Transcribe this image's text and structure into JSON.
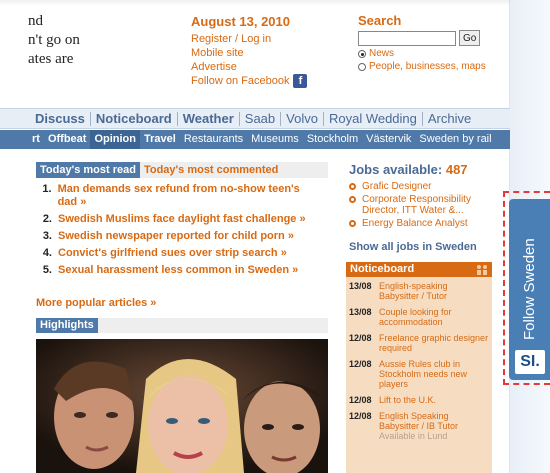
{
  "teaser": {
    "lines": [
      "nd",
      "n't go on",
      "ates are"
    ]
  },
  "header": {
    "date": "August 13, 2010",
    "links": [
      {
        "label": "Register / Log in"
      },
      {
        "label": "Mobile site"
      },
      {
        "label": "Advertise"
      },
      {
        "label": "Follow on Facebook"
      }
    ],
    "facebook_icon": "f"
  },
  "search": {
    "title": "Search",
    "input_value": "",
    "go_label": "Go",
    "options": [
      {
        "label": "News",
        "selected": true
      },
      {
        "label": "People, businesses, maps",
        "selected": false
      }
    ]
  },
  "main_nav": {
    "items": [
      {
        "label": "Discuss",
        "bold": true
      },
      {
        "label": "Noticeboard",
        "bold": true
      },
      {
        "label": "Weather",
        "bold": true
      },
      {
        "label": "Saab",
        "bold": false
      },
      {
        "label": "Volvo",
        "bold": false
      },
      {
        "label": "Royal Wedding",
        "bold": false
      },
      {
        "label": "Archive",
        "bold": false
      }
    ]
  },
  "sub_nav": {
    "items": [
      {
        "label": "rt",
        "bold": true
      },
      {
        "label": "Offbeat",
        "bold": true
      },
      {
        "label": "Opinion",
        "bold": true,
        "active": true
      },
      {
        "label": "Travel",
        "bold": true
      },
      {
        "label": "Restaurants",
        "bold": false
      },
      {
        "label": "Museums",
        "bold": false
      },
      {
        "label": "Stockholm",
        "bold": false
      },
      {
        "label": "Västervik",
        "bold": false
      },
      {
        "label": "Sweden by rail",
        "bold": false
      }
    ]
  },
  "popular": {
    "tabs": [
      {
        "label": "Today's most read",
        "active": true
      },
      {
        "label": "Today's most commented",
        "active": false
      }
    ],
    "items": [
      {
        "num": "1.",
        "title": "Man demands sex refund from no-show teen's dad »"
      },
      {
        "num": "2.",
        "title": "Swedish Muslims face daylight fast challenge »"
      },
      {
        "num": "3.",
        "title": "Swedish newspaper reported for child porn »"
      },
      {
        "num": "4.",
        "title": "Convict's girlfriend sues over strip search »"
      },
      {
        "num": "5.",
        "title": "Sexual harassment less common in Sweden »"
      }
    ],
    "more": "More popular articles »"
  },
  "highlights": {
    "label": "Highlights"
  },
  "jobs": {
    "title": "Jobs available:",
    "count": "487",
    "items": [
      {
        "label": "Grafic Designer"
      },
      {
        "label": "Corporate Responsibility Director, ITT Water &..."
      },
      {
        "label": "Energy Balance Analyst"
      }
    ],
    "all_label": "Show all jobs in Sweden"
  },
  "noticeboard": {
    "title": "Noticeboard",
    "items": [
      {
        "date": "13/08",
        "text": "English-speaking Babysitter / Tutor",
        "faded": ""
      },
      {
        "date": "13/08",
        "text": "Couple looking for accommodation",
        "faded": ""
      },
      {
        "date": "12/08",
        "text": "Freelance graphic designer required",
        "faded": ""
      },
      {
        "date": "12/08",
        "text": "Aussie Rules club in Stockholm needs new players",
        "faded": ""
      },
      {
        "date": "12/08",
        "text": "Lift to the U.K.",
        "faded": ""
      },
      {
        "date": "12/08",
        "text": "English Speaking Babysitter / IB Tutor",
        "faded": "Available in Lund"
      }
    ]
  },
  "follow": {
    "label": "Follow Sweden",
    "logo": "SI."
  },
  "colors": {
    "accent": "#d86a13",
    "nav_blue": "#4f79a8",
    "link_blue": "#4a6a96",
    "noticeboard_bg": "#f6ddc2"
  }
}
